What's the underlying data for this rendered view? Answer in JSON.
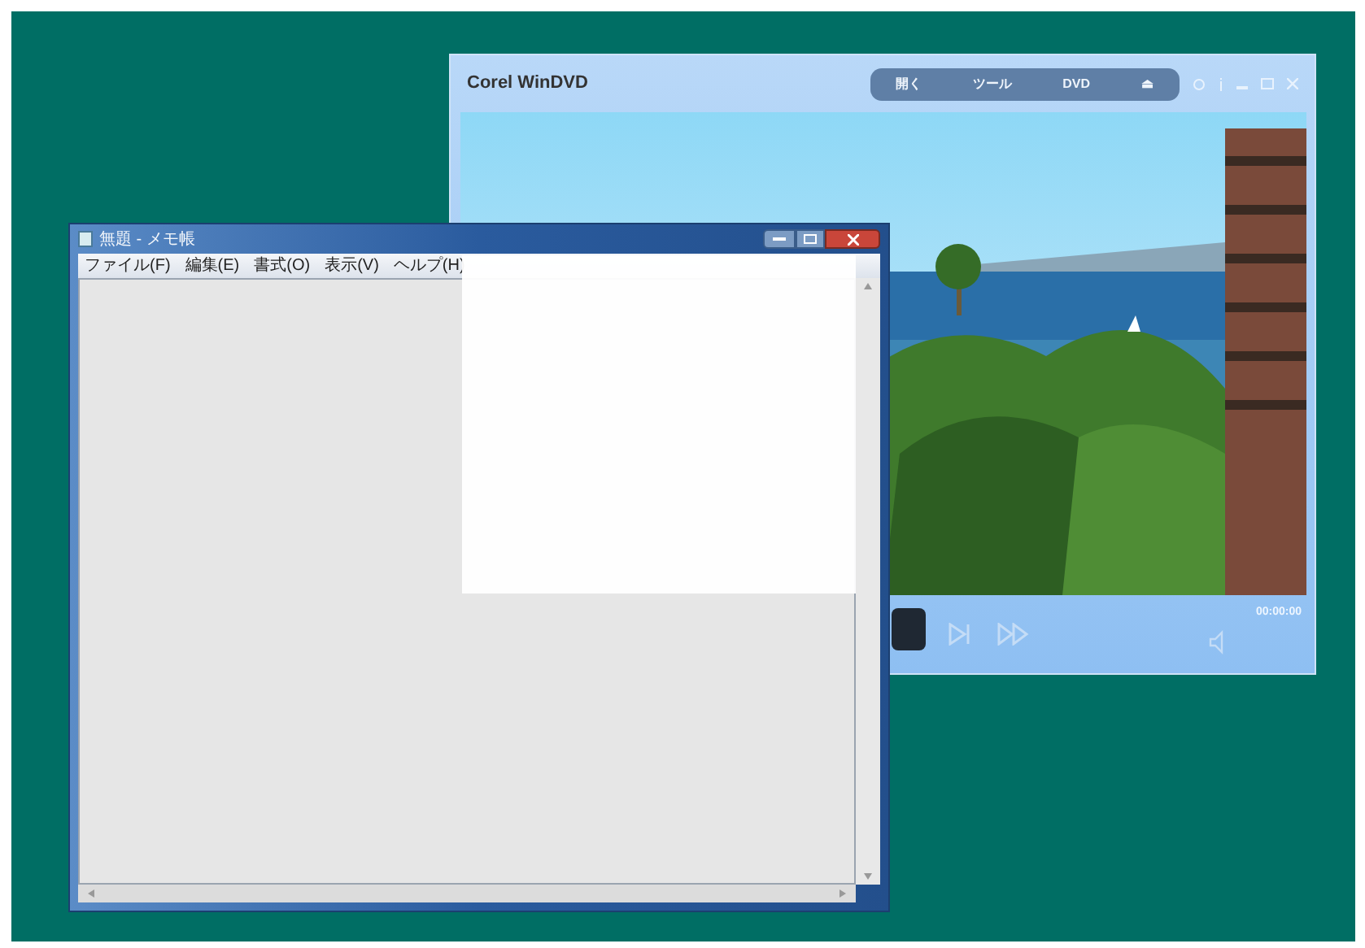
{
  "dvd_window": {
    "title": "Corel WinDVD",
    "toolbar": [
      {
        "label": "開く"
      },
      {
        "label": "ツール"
      },
      {
        "label": "DVD"
      },
      {
        "label": "⏏"
      }
    ],
    "time": "00:00:00"
  },
  "notepad": {
    "title": "無題 - メモ帳",
    "menus": [
      {
        "label": "ファイル(F)"
      },
      {
        "label": "編集(E)"
      },
      {
        "label": "書式(O)"
      },
      {
        "label": "表示(V)"
      },
      {
        "label": "ヘルプ(H)"
      }
    ]
  }
}
